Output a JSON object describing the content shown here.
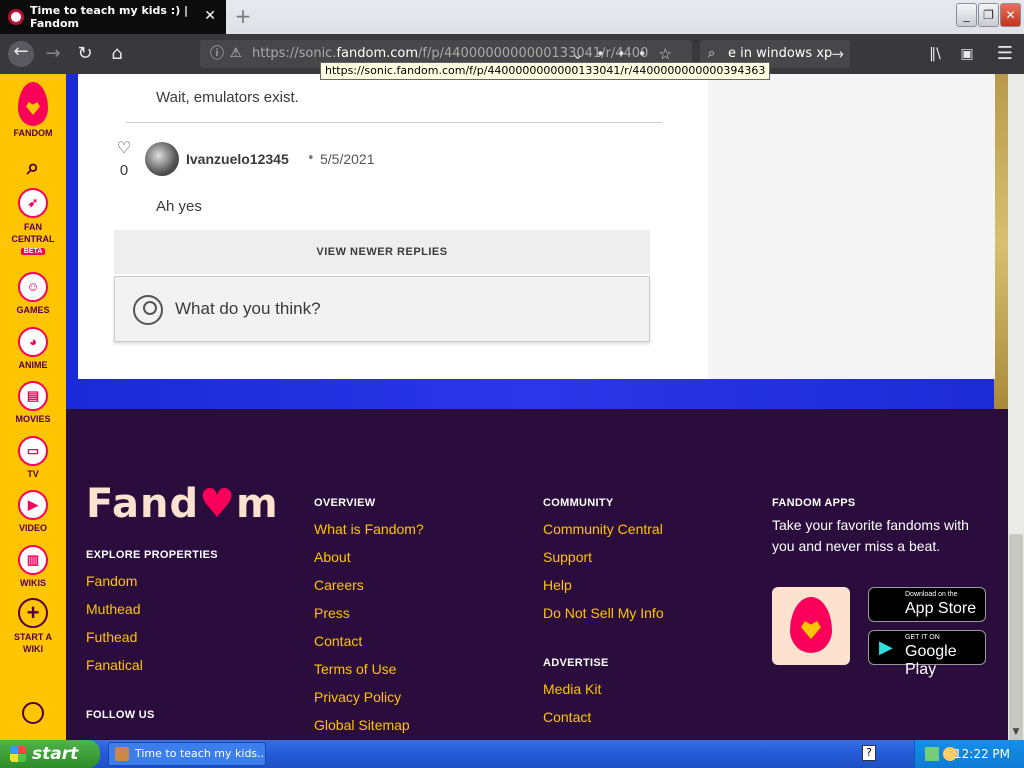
{
  "browser": {
    "tab_title": "Time to teach my kids :) | Fandom",
    "new_tab_symbol": "+",
    "url_prefix": "https://sonic.",
    "url_host": "fandom.com",
    "url_rest": "/f/p/4400000000000133041/r/4400",
    "search_text": "e in windows xp",
    "tooltip": "https://sonic.fandom.com/f/p/4400000000000133041/r/4400000000000394363"
  },
  "sidebar": {
    "logo_label": "FANDOM",
    "items": [
      {
        "label": "FAN CENTRAL",
        "badge": "BETA",
        "icon": "rocket-icon"
      },
      {
        "label": "GAMES",
        "icon": "gamepad-icon"
      },
      {
        "label": "ANIME",
        "icon": "anime-face-icon"
      },
      {
        "label": "MOVIES",
        "icon": "clapperboard-icon"
      },
      {
        "label": "TV",
        "icon": "tv-icon"
      },
      {
        "label": "VIDEO",
        "icon": "play-icon"
      },
      {
        "label": "WIKIS",
        "icon": "book-icon"
      },
      {
        "label": "START A WIKI",
        "icon": "plus-circle-icon"
      }
    ]
  },
  "discussion": {
    "previous_reply": "Wait, emulators exist.",
    "likes": "0",
    "username": "Ivanzuelo12345",
    "separator": "•",
    "date": "5/5/2021",
    "reply": "Ah yes",
    "view_newer": "VIEW NEWER REPLIES",
    "composer_placeholder": "What do you think?"
  },
  "footer": {
    "logo_text_a": "Fand",
    "logo_text_b": "m",
    "explore": {
      "heading": "EXPLORE PROPERTIES",
      "links": [
        "Fandom",
        "Muthead",
        "Futhead",
        "Fanatical"
      ]
    },
    "follow_us": "FOLLOW US",
    "overview": {
      "heading": "OVERVIEW",
      "links": [
        "What is Fandom?",
        "About",
        "Careers",
        "Press",
        "Contact",
        "Terms of Use",
        "Privacy Policy",
        "Global Sitemap"
      ]
    },
    "community": {
      "heading": "COMMUNITY",
      "links": [
        "Community Central",
        "Support",
        "Help",
        "Do Not Sell My Info"
      ]
    },
    "advertise": {
      "heading": "ADVERTISE",
      "links": [
        "Media Kit",
        "Contact"
      ]
    },
    "apps": {
      "heading": "FANDOM APPS",
      "text": "Take your favorite fandoms with you and never miss a beat.",
      "appstore_small": "Download on the",
      "appstore_big": "App Store",
      "googleplay_small": "GET IT ON",
      "googleplay_big": "Google Play"
    }
  },
  "taskbar": {
    "start_label": "start",
    "task_label": "Time to teach my kids...",
    "clock": "12:22 PM"
  },
  "colors": {
    "fandom_yellow": "#ffc500",
    "fandom_pink": "#fa005a",
    "footer_bg": "#2a0c3d",
    "hero_blue": "#1a2ad8"
  }
}
